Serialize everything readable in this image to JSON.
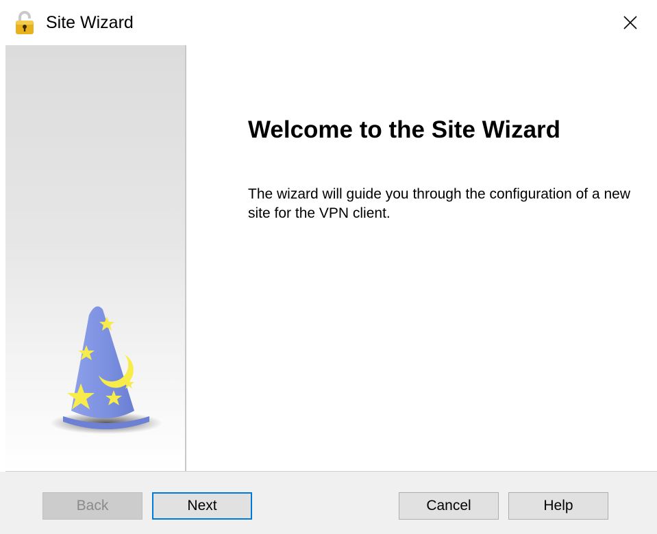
{
  "window": {
    "title": "Site Wizard",
    "icon": "padlock-icon",
    "close_icon": "close-icon"
  },
  "side_panel": {
    "illustration": "wizard-hat-icon"
  },
  "main": {
    "heading": "Welcome to the Site Wizard",
    "body": "The wizard will guide you through the configuration of a new site for the VPN client."
  },
  "buttons": {
    "back_label": "Back",
    "next_label": "Next",
    "cancel_label": "Cancel",
    "help_label": "Help"
  },
  "colors": {
    "hat_body": "#7b8fe0",
    "hat_stars": "#f7ec4a",
    "default_button_border": "#0078d7",
    "padlock": "#e8b21e"
  }
}
